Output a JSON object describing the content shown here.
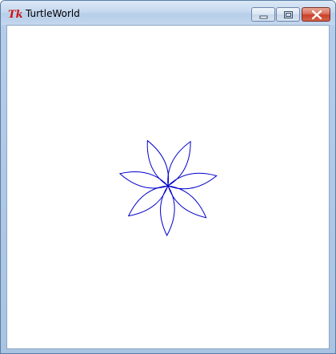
{
  "window": {
    "title": "TurtleWorld",
    "app_icon": "tk-feather-icon",
    "controls": {
      "minimize_icon": "minimize-icon",
      "maximize_icon": "maximize-icon",
      "close_icon": "close-icon"
    }
  },
  "drawing": {
    "shape": "flower",
    "petal_count": 7,
    "stroke_color": "#0000cc"
  }
}
